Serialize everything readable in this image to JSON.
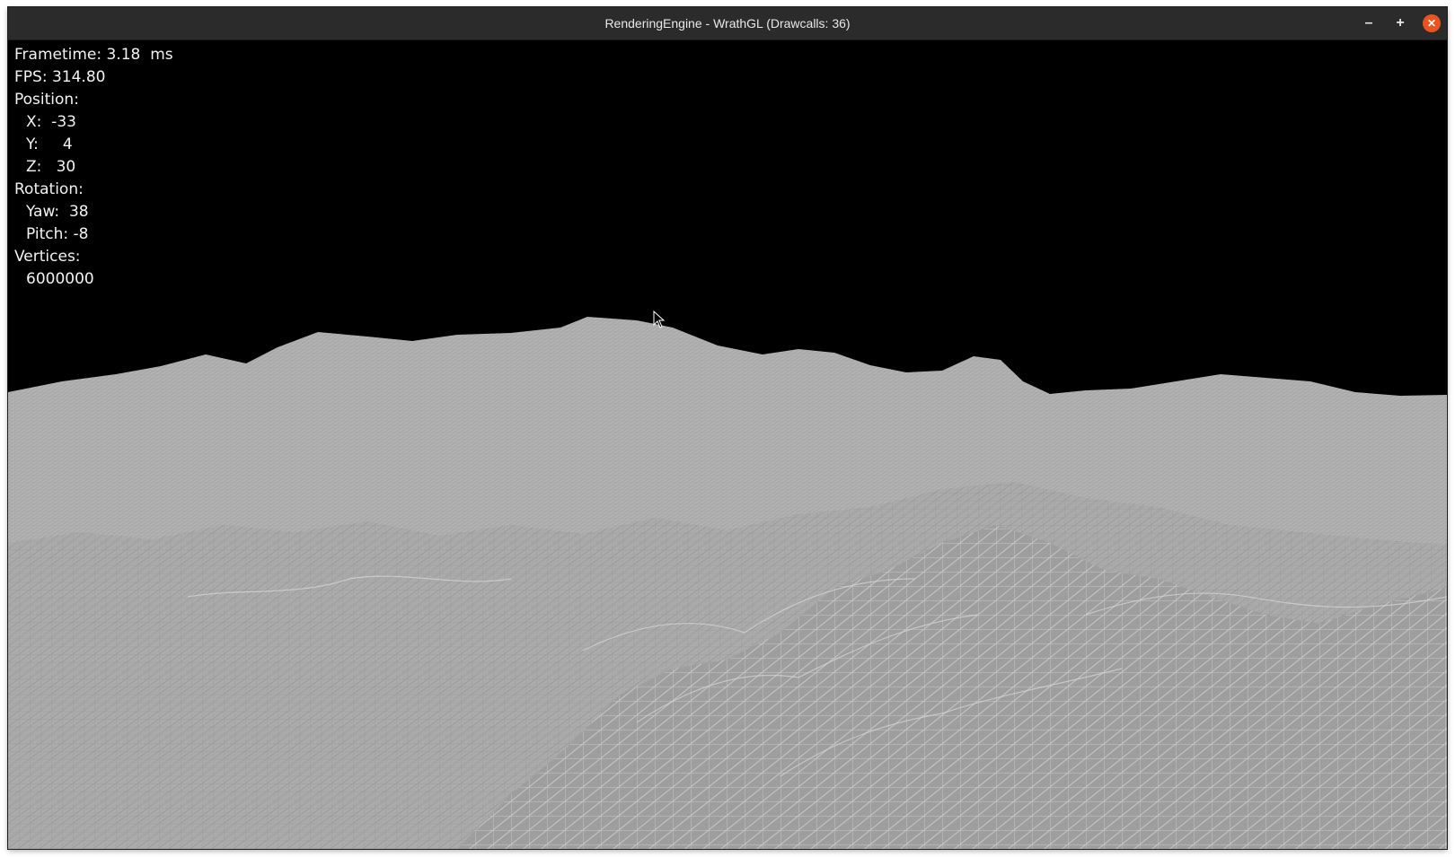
{
  "window": {
    "title": "RenderingEngine - WrathGL (Drawcalls: 36)",
    "controls": {
      "minimize": "–",
      "maximize": "+",
      "close": "✕"
    },
    "close_color": "#e95420"
  },
  "hud": {
    "frametime_label": "Frametime:",
    "frametime_value": "3.18",
    "frametime_unit": "ms",
    "fps_label": "FPS:",
    "fps_value": "314.80",
    "position_label": "Position:",
    "x_label": "X:",
    "x_value": "-33",
    "y_label": "Y:",
    "y_value": "4",
    "z_label": "Z:",
    "z_value": "30",
    "rotation_label": "Rotation:",
    "yaw_label": "Yaw:",
    "yaw_value": "38",
    "pitch_label": "Pitch:",
    "pitch_value": "-8",
    "vertices_label": "Vertices:",
    "vertices_value": "6000000"
  },
  "scene": {
    "description_icon": "wireframe-terrain",
    "sky_color": "#000000",
    "terrain_color": "#a9a9a9",
    "wire_color": "#d4d4d4"
  }
}
